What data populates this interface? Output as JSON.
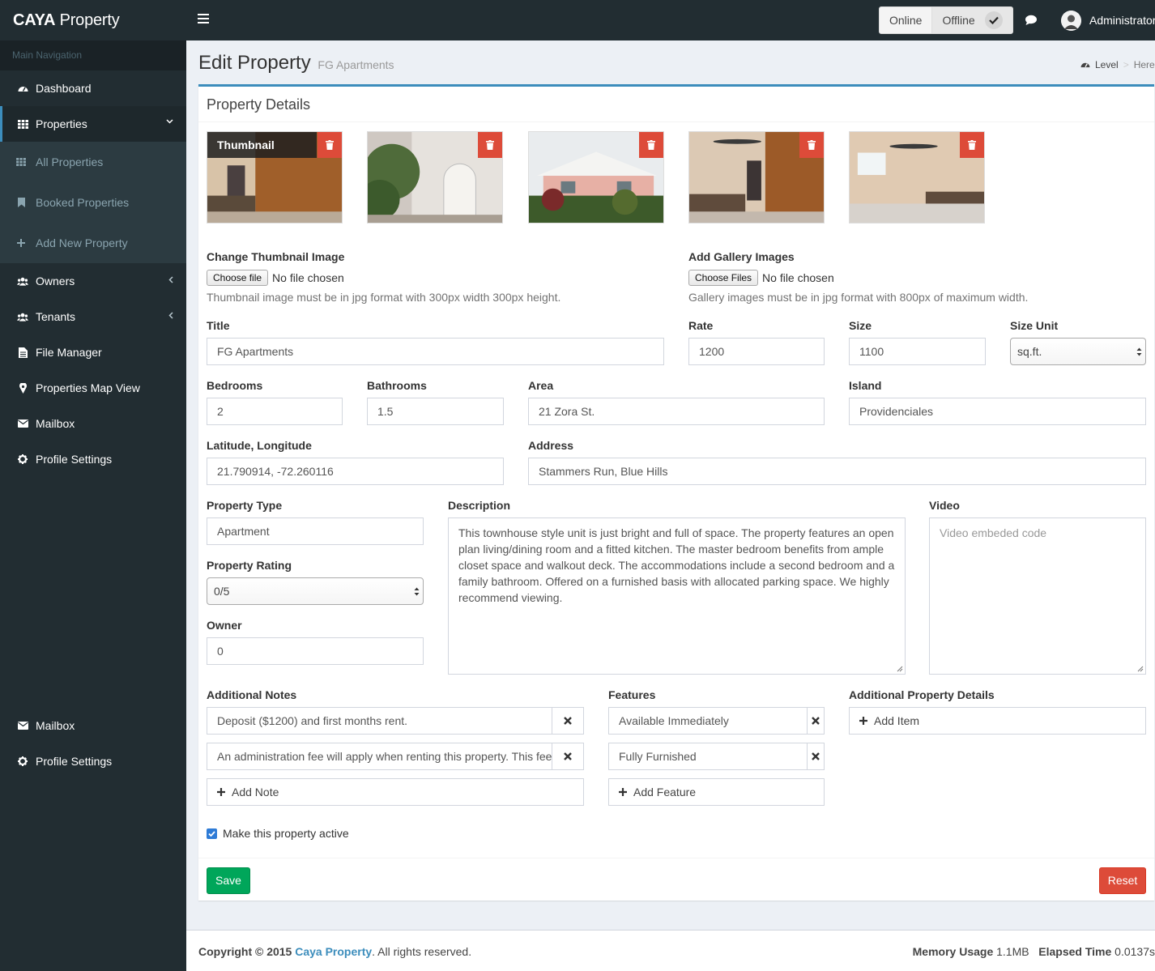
{
  "header": {
    "brand_bold": "CAYA",
    "brand_rest": "Property",
    "status_online": "Online",
    "status_offline": "Offline",
    "user": "Administrator"
  },
  "sidebar": {
    "section": "Main Navigation",
    "items": [
      {
        "label": "Dashboard",
        "icon": "dashboard-icon"
      },
      {
        "label": "Properties",
        "icon": "grid-icon"
      },
      {
        "label": "Owners",
        "icon": "users-icon"
      },
      {
        "label": "Tenants",
        "icon": "users-icon"
      },
      {
        "label": "File Manager",
        "icon": "file-icon"
      },
      {
        "label": "Properties Map View",
        "icon": "map-marker-icon"
      },
      {
        "label": "Mailbox",
        "icon": "envelope-icon"
      },
      {
        "label": "Profile Settings",
        "icon": "gear-icon"
      }
    ],
    "submenu": [
      {
        "label": "All Properties",
        "icon": "grid-icon"
      },
      {
        "label": "Booked Properties",
        "icon": "bookmark-icon"
      },
      {
        "label": "Add New Property",
        "icon": "plus-icon"
      }
    ],
    "bottom": [
      {
        "label": "Mailbox",
        "icon": "envelope-icon"
      },
      {
        "label": "Profile Settings",
        "icon": "gear-icon"
      }
    ]
  },
  "page": {
    "title": "Edit Property",
    "subtitle": "FG Apartments",
    "breadcrumb": [
      "Level",
      "Here"
    ]
  },
  "form": {
    "box_title": "Property Details",
    "thumbnail_label": "Thumbnail",
    "change_thumb_label": "Change Thumbnail Image",
    "choose_file": "Choose file",
    "no_file": "No file chosen",
    "thumb_help": "Thumbnail image must be in jpg format with 300px width 300px height.",
    "gallery_label": "Add Gallery Images",
    "choose_files": "Choose Files",
    "gallery_help": "Gallery images must be in jpg format with 800px of maximum width.",
    "title_label": "Title",
    "title_value": "FG Apartments",
    "rate_label": "Rate",
    "rate_value": "1200",
    "size_label": "Size",
    "size_value": "1100",
    "size_unit_label": "Size Unit",
    "size_unit_value": "sq.ft.",
    "bedrooms_label": "Bedrooms",
    "bedrooms_value": "2",
    "bathrooms_label": "Bathrooms",
    "bathrooms_value": "1.5",
    "area_label": "Area",
    "area_value": "21 Zora St.",
    "island_label": "Island",
    "island_value": "Providenciales",
    "latlng_label": "Latitude, Longitude",
    "latlng_value": "21.790914, -72.260116",
    "address_label": "Address",
    "address_value": "Stammers Run, Blue Hills",
    "type_label": "Property Type",
    "type_value": "Apartment",
    "rating_label": "Property Rating",
    "rating_value": "0/5",
    "owner_label": "Owner",
    "owner_value": "0",
    "description_label": "Description",
    "description_value": "This townhouse style unit is just bright and full of space. The property features an open plan living/dining room and a fitted kitchen. The master bedroom benefits from ample closet space and walkout deck. The accommodations include a second bedroom and a family bathroom. Offered on a furnished basis with allocated parking space. We highly recommend viewing.",
    "video_label": "Video",
    "video_placeholder": "Video embeded code",
    "notes_label": "Additional Notes",
    "notes": [
      "Deposit ($1200) and first months rent.",
      "An administration fee will apply when renting this property. This fee is"
    ],
    "add_note": "Add Note",
    "features_label": "Features",
    "features": [
      "Available Immediately",
      "Fully Furnished"
    ],
    "add_feature": "Add Feature",
    "details_label": "Additional Property Details",
    "add_item": "Add Item",
    "active_label": "Make this property active",
    "save": "Save",
    "reset": "Reset"
  },
  "footer": {
    "copyright": "Copyright © 2015",
    "brand": "Caya Property",
    "rights": ". All rights reserved.",
    "memory_label": "Memory Usage",
    "memory_value": "1.1MB",
    "elapsed_label": "Elapsed Time",
    "elapsed_value": "0.0137s"
  },
  "colors": {
    "sidebar_bg": "#222d32",
    "accent": "#3c8dbc",
    "save": "#00a65a",
    "danger": "#dd4b39"
  }
}
